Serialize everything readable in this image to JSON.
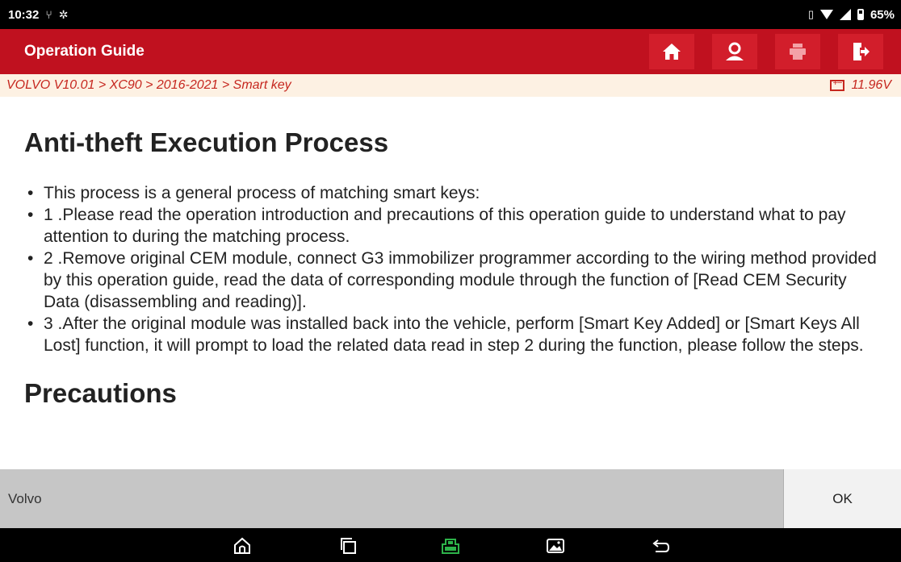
{
  "status_bar": {
    "time": "10:32",
    "battery": "65%"
  },
  "header": {
    "title": "Operation Guide",
    "icons": [
      "home-icon",
      "user-icon",
      "print-icon",
      "exit-icon"
    ]
  },
  "breadcrumb": {
    "path": "VOLVO V10.01 > XC90 > 2016-2021 > Smart key",
    "voltage": "11.96V"
  },
  "main": {
    "heading": "Anti-theft Execution Process",
    "steps": [
      "This process is a general process of matching smart keys:",
      "1 .Please read the operation introduction and precautions of this operation guide to understand what to pay attention to during the matching process.",
      "2 .Remove original CEM module, connect G3 immobilizer programmer according to the wiring method provided by this operation guide, read the data of corresponding module through the function of [Read CEM Security Data (disassembling and reading)].",
      "3 .After the original module was installed back into the vehicle, perform [Smart Key Added] or [Smart Keys All Lost] function, it will prompt to load the related data read in step 2 during the function, please follow the steps."
    ],
    "section2_heading": "Precautions"
  },
  "footer": {
    "label": "Volvo",
    "ok_label": "OK"
  },
  "colors": {
    "header_red": "#c0111f",
    "crumb_text": "#c6271f",
    "crumb_bg": "#fdf1e3",
    "vci_green": "#2db34a"
  }
}
